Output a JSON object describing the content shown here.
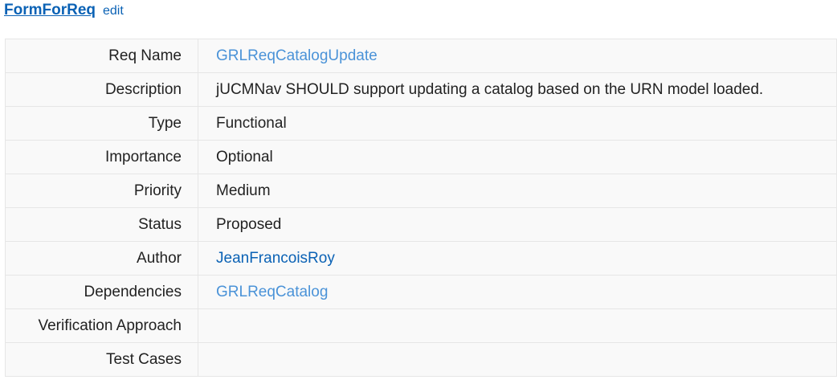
{
  "header": {
    "title": "FormForReq",
    "edit": "edit"
  },
  "rows": [
    {
      "label": "Req Name",
      "value": "GRLReqCatalogUpdate",
      "kind": "link-new"
    },
    {
      "label": "Description",
      "value": "jUCMNav SHOULD support updating a catalog based on the URN model loaded.",
      "kind": "text"
    },
    {
      "label": "Type",
      "value": "Functional",
      "kind": "text"
    },
    {
      "label": "Importance",
      "value": "Optional",
      "kind": "text"
    },
    {
      "label": "Priority",
      "value": "Medium",
      "kind": "text"
    },
    {
      "label": "Status",
      "value": "Proposed",
      "kind": "text"
    },
    {
      "label": "Author",
      "value": "JeanFrancoisRoy",
      "kind": "link-exist"
    },
    {
      "label": "Dependencies",
      "value": "GRLReqCatalog",
      "kind": "link-new"
    },
    {
      "label": "Verification Approach",
      "value": "",
      "kind": "text"
    },
    {
      "label": "Test Cases",
      "value": "",
      "kind": "text"
    }
  ],
  "colors": {
    "link": "#0b62b5",
    "link_new": "#4b93d8",
    "row_background": "#f9f9f9",
    "border": "#e6e6e6"
  }
}
